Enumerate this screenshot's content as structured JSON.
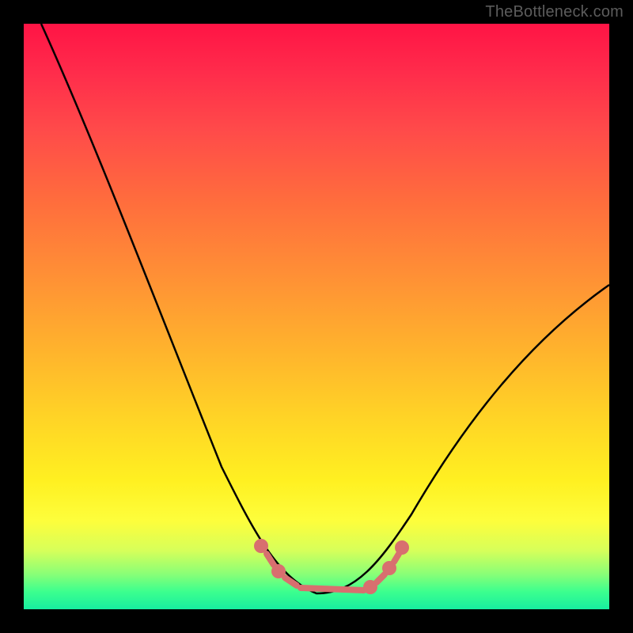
{
  "watermark": "TheBottleneck.com",
  "chart_data": {
    "type": "line",
    "title": "",
    "xlabel": "",
    "ylabel": "",
    "description": "Bottleneck-style performance curve: a U/V shaped valley over a vertical gradient from red (top, high bottleneck) to green (bottom, no bottleneck). The curve descends steeply from the top-left, bottoms out around x≈0.5, and rises again toward the upper-right. The valley floor region near the bottom is annotated by a chain of red/pink dots and short segments.",
    "x_range": [
      0,
      1
    ],
    "y_range": [
      0,
      1
    ],
    "gradient_stops": [
      {
        "y": 0.0,
        "color": "#ff1445"
      },
      {
        "y": 0.18,
        "color": "#ff4a4a"
      },
      {
        "y": 0.42,
        "color": "#ff8d36"
      },
      {
        "y": 0.67,
        "color": "#ffd326"
      },
      {
        "y": 0.85,
        "color": "#fdfe3c"
      },
      {
        "y": 0.94,
        "color": "#89ff77"
      },
      {
        "y": 1.0,
        "color": "#17eea0"
      }
    ],
    "series": [
      {
        "name": "bottleneck-curve",
        "x": [
          0.03,
          0.08,
          0.14,
          0.2,
          0.26,
          0.32,
          0.37,
          0.41,
          0.44,
          0.47,
          0.5,
          0.53,
          0.56,
          0.59,
          0.62,
          0.66,
          0.71,
          0.78,
          0.86,
          0.95,
          1.0
        ],
        "y": [
          0.0,
          0.14,
          0.3,
          0.46,
          0.61,
          0.74,
          0.83,
          0.9,
          0.94,
          0.97,
          0.99,
          0.99,
          0.98,
          0.96,
          0.93,
          0.89,
          0.83,
          0.74,
          0.63,
          0.51,
          0.45
        ],
        "note": "y is fraction from top (0) to bottom (1), i.e., lower bottleneck at higher y"
      }
    ],
    "highlight": {
      "name": "valley-markers",
      "color": "#e07a7a",
      "points": [
        {
          "x": 0.41,
          "y": 0.895
        },
        {
          "x": 0.425,
          "y": 0.915
        },
        {
          "x": 0.44,
          "y": 0.935
        },
        {
          "x": 0.46,
          "y": 0.955
        },
        {
          "x": 0.49,
          "y": 0.965
        },
        {
          "x": 0.52,
          "y": 0.965
        },
        {
          "x": 0.55,
          "y": 0.962
        },
        {
          "x": 0.575,
          "y": 0.955
        },
        {
          "x": 0.595,
          "y": 0.94
        },
        {
          "x": 0.61,
          "y": 0.92
        },
        {
          "x": 0.625,
          "y": 0.9
        }
      ]
    }
  }
}
